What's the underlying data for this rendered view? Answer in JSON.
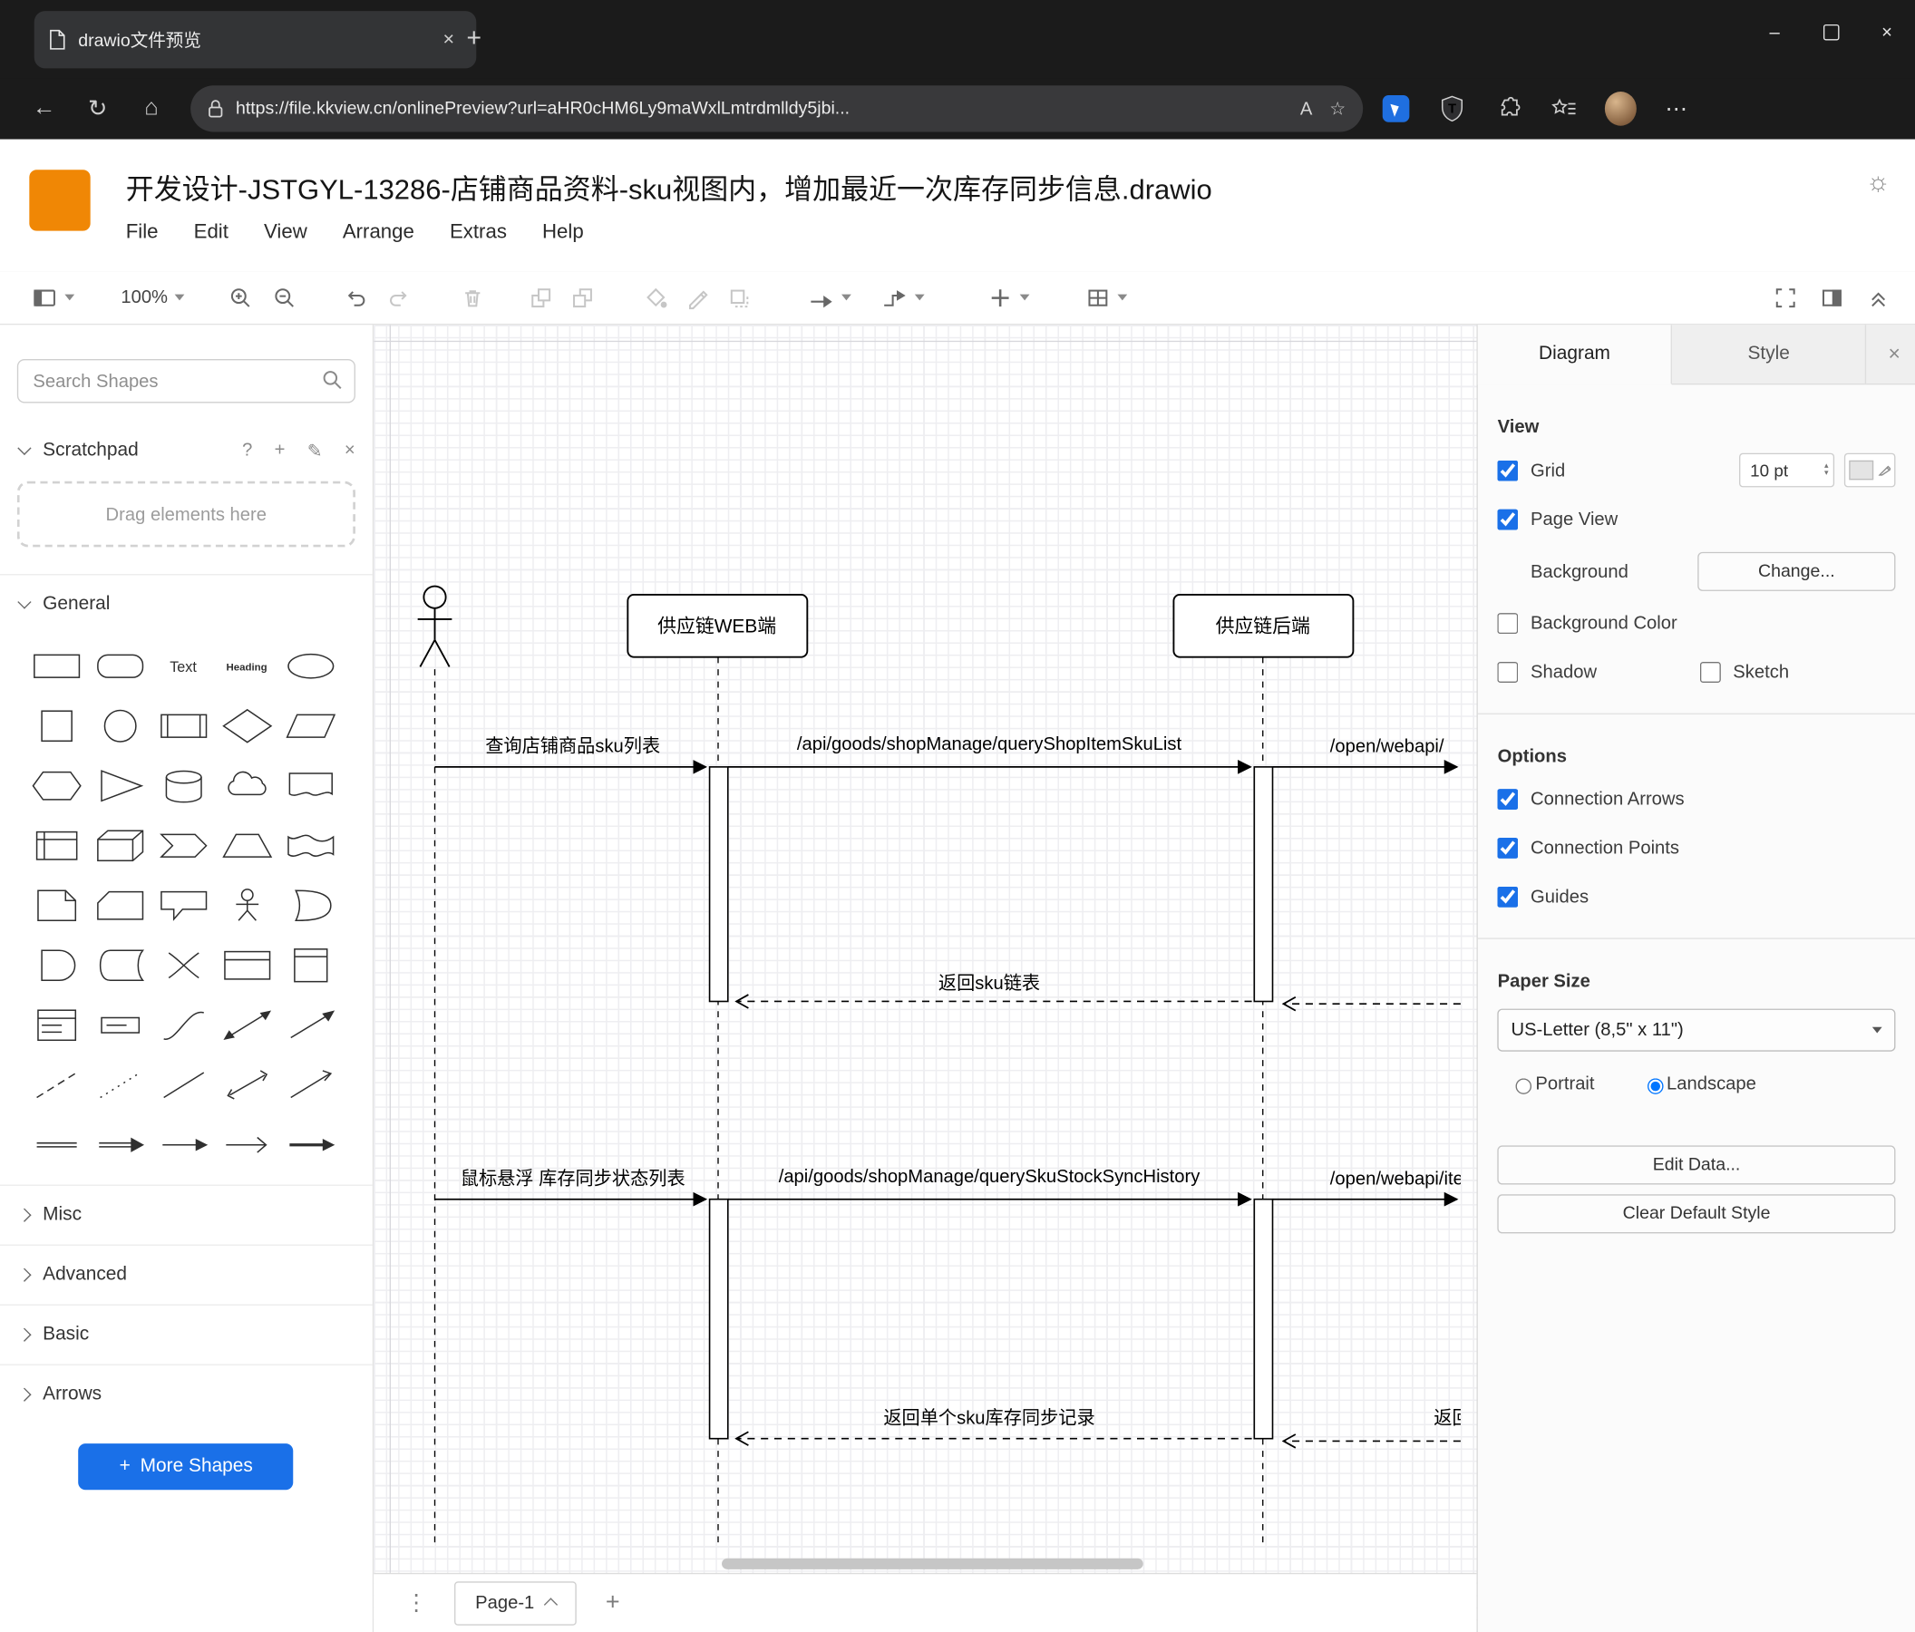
{
  "colors": {
    "chrome_bg": "#1b1b1b",
    "drawio_orange": "#f08705",
    "primary_blue": "#1a70e8",
    "canvas_grid": "#eeeef1"
  },
  "icons": {
    "back": "←",
    "refresh": "↻",
    "home": "⌂",
    "reader": "A",
    "star": "☆",
    "more": "⋯",
    "sun": "☼",
    "dots_vertical": "⋮",
    "new_tab": "+",
    "plus": "+",
    "minimize": "–",
    "close": "×",
    "tab_close": "×",
    "panel_close": "×",
    "question": "?",
    "pencil": "✎"
  },
  "window": {
    "tab_title": "drawio文件预览",
    "url": "https://file.kkview.cn/onlinePreview?url=aHR0cHM6Ly9maWxlLmtrdmlldy5jbi..."
  },
  "app": {
    "title": "开发设计-JSTGYL-13286-店铺商品资料-sku视图内，增加最近一次库存同步信息.drawio",
    "menus": [
      "File",
      "Edit",
      "View",
      "Arrange",
      "Extras",
      "Help"
    ],
    "toolbar": {
      "zoom": "100%"
    }
  },
  "sidebar": {
    "search_placeholder": "Search Shapes",
    "scratchpad_title": "Scratchpad",
    "drop_hint": "Drag elements here",
    "sections": [
      "General",
      "Misc",
      "Advanced",
      "Basic",
      "Arrows"
    ],
    "more_shapes_label": "More Shapes",
    "text_shape_label": "Text",
    "heading_shape_label": "Heading",
    "shapes": [
      "rectangle",
      "rounded-rectangle",
      "text",
      "heading",
      "ellipse",
      "square",
      "circle",
      "process",
      "diamond",
      "parallelogram",
      "hexagon",
      "triangle",
      "cylinder",
      "cloud",
      "document",
      "internal-storage",
      "cube",
      "step",
      "trapezoid",
      "tape",
      "note",
      "card",
      "callout",
      "actor",
      "or",
      "and",
      "data-storage",
      "switch",
      "container",
      "vertical-container",
      "list",
      "list-item",
      "curve",
      "bidirectional-arrow",
      "directional-arrow",
      "dashed-line",
      "dotted-line",
      "line",
      "bidirectional-connector",
      "directional-connector",
      "link",
      "arrow-link",
      "simple-arrow",
      "thin-arrow",
      "filled-edge"
    ]
  },
  "canvas": {
    "page_tab": "Page-1",
    "diagram": {
      "participants": [
        {
          "label": "供应链WEB端"
        },
        {
          "label": "供应链后端"
        }
      ],
      "messages": {
        "m1": "查询店铺商品sku列表",
        "m2": "/api/goods/shopManage/queryShopItemSkuList",
        "m3": "/open/webapi/",
        "r1": "返回sku链表",
        "m4": "鼠标悬浮 库存同步状态列表",
        "m5": "/api/goods/shopManage/querySkuStockSyncHistory",
        "m6": "/open/webapi/iten",
        "r2": "返回单个sku库存同步记录",
        "r3": "返回"
      }
    }
  },
  "format": {
    "tabs": [
      "Diagram",
      "Style"
    ],
    "view": {
      "heading": "View",
      "grid": "Grid",
      "grid_size": "10 pt",
      "grid_checked": true,
      "page_view": "Page View",
      "page_view_checked": true,
      "background": "Background",
      "change": "Change...",
      "background_color": "Background Color",
      "background_color_checked": false,
      "shadow": "Shadow",
      "shadow_checked": false,
      "sketch": "Sketch",
      "sketch_checked": false
    },
    "options": {
      "heading": "Options",
      "items": [
        "Connection Arrows",
        "Connection Points",
        "Guides"
      ],
      "checked": [
        true,
        true,
        true
      ]
    },
    "paper": {
      "heading": "Paper Size",
      "size": "US-Letter (8,5\" x 11\")",
      "portrait": "Portrait",
      "landscape": "Landscape",
      "portrait_selected": false,
      "landscape_selected": true
    },
    "buttons": {
      "edit_data": "Edit Data...",
      "clear_default": "Clear Default Style"
    }
  }
}
